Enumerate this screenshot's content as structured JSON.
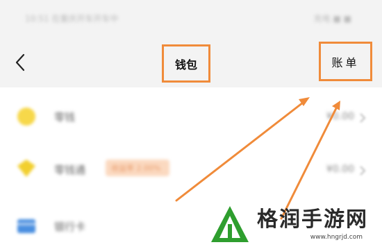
{
  "status_bar": {
    "left_text": "10:51 在重庆开车开车中",
    "right_text": "充电 ■ ■"
  },
  "header": {
    "title": "钱包",
    "bill_label": "账单",
    "back_icon": "chevron-left-icon"
  },
  "list": {
    "items": [
      {
        "label": "零钱",
        "value": "¥0.00",
        "badge": "",
        "icon_color": "#f7d84a"
      },
      {
        "label": "零钱通",
        "value": "¥0.00",
        "badge": "收益率 2.00%",
        "icon_color": "#f2cf2e"
      },
      {
        "label": "银行卡",
        "value": "",
        "badge": "",
        "icon_color": "#4a8fe0"
      }
    ]
  },
  "annotation": {
    "highlight_color": "#f08b3a"
  },
  "watermark": {
    "name": "格润手游网",
    "url": "www.hngrjd.com",
    "logo_color": "#2e9e2e"
  }
}
